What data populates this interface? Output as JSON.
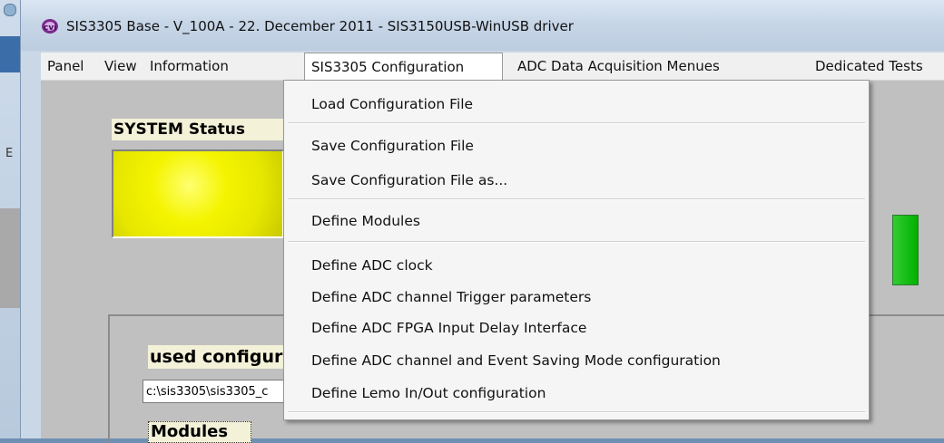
{
  "window": {
    "title": "SIS3305 Base - V_100A - 22. December 2011 - SIS3150USB-WinUSB driver",
    "icon": "cvi-app-icon"
  },
  "background": {
    "letter": "E"
  },
  "menubar": {
    "items": [
      {
        "label": "Panel"
      },
      {
        "label": "View"
      },
      {
        "label": "Information"
      },
      {
        "label": "SIS3305 Configuration"
      },
      {
        "label": "ADC Data Acquisition Menues"
      },
      {
        "label": "Dedicated Tests"
      }
    ],
    "active_index": 3
  },
  "dropdown": {
    "items": [
      {
        "label": "Load Configuration File"
      },
      {
        "label": "Save Configuration File"
      },
      {
        "label": "Save Configuration File as..."
      },
      {
        "label": "Define Modules"
      },
      {
        "label": "Define ADC clock"
      },
      {
        "label": "Define ADC channel Trigger parameters"
      },
      {
        "label": "Define ADC FPGA Input Delay Interface"
      },
      {
        "label": "Define ADC channel  and Event Saving Mode configuration"
      },
      {
        "label": "Define Lemo In/Out configuration"
      }
    ]
  },
  "panel": {
    "system_status_label": "SYSTEM Status",
    "system_status_color": "#f4f400",
    "secondary_indicator_color": "#00b000",
    "used_config_label": "used configura",
    "config_path": "c:\\sis3305\\sis3305_c",
    "modules_label": "Modules"
  }
}
